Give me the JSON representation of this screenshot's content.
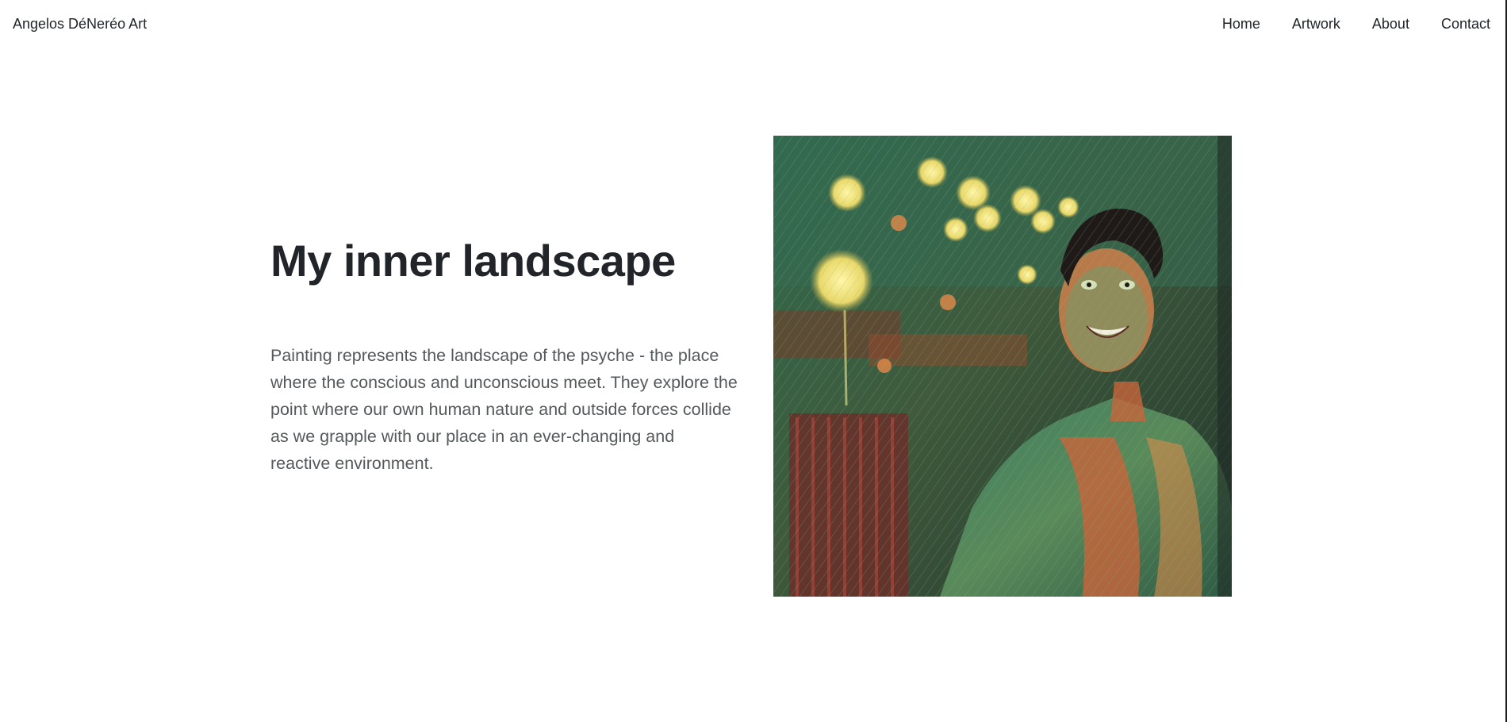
{
  "navbar": {
    "brand": "Angelos DéNeréo Art",
    "links": [
      {
        "label": "Home"
      },
      {
        "label": "Artwork"
      },
      {
        "label": "About"
      },
      {
        "label": "Contact"
      }
    ]
  },
  "hero": {
    "title": "My inner landscape",
    "text": "Painting represents the landscape of the psyche - the place where the conscious and unconscious meet. They explore the point where our own human nature and outside forces collide as we grapple with our place in an ever-changing and reactive environment.",
    "image_subject": "stylized painted portrait of a smiling man in a green jacket in a restaurant"
  },
  "colors": {
    "text": "#212529",
    "body_text": "#55595c",
    "background": "#ffffff",
    "painting_green": "#2c5a45",
    "painting_orange": "#c8643a",
    "painting_yellow": "#f3e68a"
  }
}
